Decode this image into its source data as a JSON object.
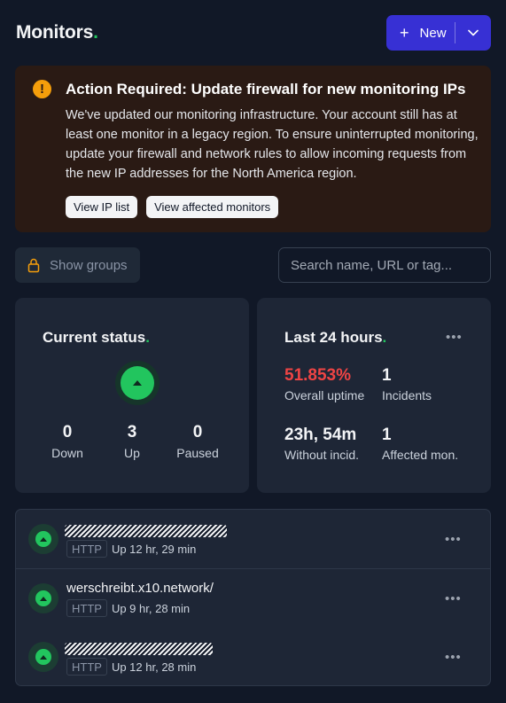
{
  "header": {
    "title": "Monitors",
    "title_dot": ".",
    "new_label": "New",
    "plus_icon": "plus-icon",
    "caret_icon": "chevron-down-icon",
    "accent_color": "#3730d4"
  },
  "alert": {
    "icon": "exclamation-icon",
    "title": "Action Required: Update firewall for new monitoring IPs",
    "body": "We've updated our monitoring infrastructure. Your account still has at least one monitor in a legacy region. To ensure uninterrupted monitoring, update your firewall and network rules to allow incoming requests from the new IP addresses for the North America region.",
    "button_ip_list": "View IP list",
    "button_affected": "View affected monitors"
  },
  "toolbar": {
    "show_groups_label": "Show groups",
    "lock_icon": "lock-icon",
    "search_placeholder": "Search name, URL or tag..."
  },
  "current_status": {
    "title": "Current status",
    "dot": ".",
    "icon": "status-up-icon",
    "down_count": "0",
    "down_label": "Down",
    "up_count": "3",
    "up_label": "Up",
    "paused_count": "0",
    "paused_label": "Paused"
  },
  "last_24h": {
    "title": "Last 24 hours",
    "dot": ".",
    "more_icon": "more-icon",
    "uptime_value": "51.853%",
    "uptime_label": "Overall uptime",
    "incidents_value": "1",
    "incidents_label": "Incidents",
    "without_value": "23h, 54m",
    "without_label": "Without incid.",
    "affected_value": "1",
    "affected_label": "Affected mon."
  },
  "monitors": [
    {
      "name": "",
      "redacted": true,
      "type": "HTTP",
      "uptime": "Up 12 hr, 29 min"
    },
    {
      "name": "werschreibt.x10.network/",
      "redacted": false,
      "type": "HTTP",
      "uptime": "Up 9 hr, 28 min"
    },
    {
      "name": "",
      "redacted": true,
      "type": "HTTP",
      "uptime": "Up 12 hr, 28 min"
    }
  ],
  "colors": {
    "background": "#111827",
    "card": "#1e2636",
    "up_green": "#22c55e",
    "alert_bg": "#2a1a14",
    "alert_icon": "#f59e0b",
    "uptime_red": "#ef4444"
  }
}
